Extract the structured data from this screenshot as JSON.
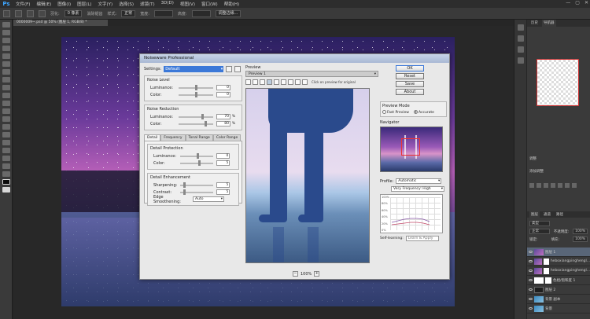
{
  "app": {
    "logo": "Ps",
    "menu": [
      "文件(F)",
      "编辑(E)",
      "图像(I)",
      "图层(L)",
      "文字(Y)",
      "选择(S)",
      "滤镜(T)",
      "3D(D)",
      "视图(V)",
      "窗口(W)",
      "帮助(H)"
    ],
    "window_buttons": [
      "—",
      "▢",
      "✕"
    ]
  },
  "options_bar": {
    "feather_label": "羽化:",
    "feather_value": "0 像素",
    "antialias_label": "消除锯齿",
    "style_label": "样式:",
    "style_value": "正常",
    "width_label": "宽度:",
    "height_label": "高度:",
    "refine_label": "调整边缘..."
  },
  "document_tab": "0000009~.psd @ 50% (图层 1, RGB/8) *",
  "right_panels": {
    "tabs": [
      "历史",
      "导航器"
    ],
    "adjust_title": "调整",
    "adjust_subtitle": "添加调整",
    "layers_tabs": [
      "图层",
      "通道",
      "路径"
    ],
    "kind_label": "类型",
    "mode_label": "正常",
    "opacity_label": "不透明度:",
    "opacity_value": "100%",
    "lock_label": "锁定:",
    "fill_label": "填充:",
    "fill_value": "100%",
    "layers": [
      {
        "name": "图层 1",
        "active": true,
        "thumb": "photo",
        "mask": false
      },
      {
        "name": "heboxiangpinghengl...",
        "active": false,
        "thumb": "photo",
        "mask": true
      },
      {
        "name": "heboxiangpinghengl...",
        "active": false,
        "thumb": "photo",
        "mask": true
      },
      {
        "name": "色相/饱和度 1",
        "active": false,
        "thumb": "white",
        "mask": true
      },
      {
        "name": "图层 2",
        "active": false,
        "thumb": "dark",
        "mask": false
      },
      {
        "name": "背景 副本",
        "active": false,
        "thumb": "blue",
        "mask": false
      },
      {
        "name": "背景",
        "active": false,
        "thumb": "blue",
        "mask": false
      }
    ]
  },
  "dialog": {
    "title": "Noiseware Professional",
    "settings_label": "Settings:",
    "settings_value": "Default",
    "noise_level": {
      "title": "Noise Level",
      "params": [
        {
          "label": "Luminance:",
          "value": "0",
          "unit": "",
          "pos": 0.5
        },
        {
          "label": "Color:",
          "value": "0",
          "unit": "",
          "pos": 0.5
        }
      ]
    },
    "noise_reduction": {
      "title": "Noise Reduction",
      "params": [
        {
          "label": "Luminance:",
          "value": "70",
          "unit": "%",
          "pos": 0.7
        },
        {
          "label": "Color:",
          "value": "80",
          "unit": "%",
          "pos": 0.8
        }
      ]
    },
    "tabs": [
      "Detail",
      "Frequency",
      "Tonal Range",
      "Color Range"
    ],
    "detail_protection": {
      "title": "Detail Protection",
      "params": [
        {
          "label": "Luminance:",
          "value": "0",
          "unit": "",
          "pos": 0.5
        },
        {
          "label": "Color:",
          "value": "5",
          "unit": "",
          "pos": 0.55
        }
      ]
    },
    "detail_enhancement": {
      "title": "Detail Enhancement",
      "params": [
        {
          "label": "Sharpening:",
          "value": "5",
          "unit": "",
          "pos": 0.1
        },
        {
          "label": "Contrast:",
          "value": "5",
          "unit": "",
          "pos": 0.1
        }
      ],
      "edge_label": "Edge Smoothening:",
      "edge_value": "Auto"
    },
    "preview": {
      "label": "Preview",
      "tab": "Preview 1",
      "hint": "Click on preview for original",
      "zoom": "100%"
    },
    "buttons": [
      "OK",
      "Reset",
      "Save",
      "About"
    ],
    "preview_mode": {
      "title": "Preview Mode",
      "fast": "Fast Preview",
      "accurate": "Accurate",
      "selected": "accurate"
    },
    "navigator_label": "Navigator",
    "profile_label": "Profile:",
    "profile_value": "Automatic",
    "frequency_value": "Very Frequency: High",
    "graph_y_labels": [
      "100%",
      "80%",
      "60%",
      "40%",
      "20%",
      "0%"
    ],
    "self_learning_label": "Self-learning:",
    "self_learning_value": "Learn & Apply"
  }
}
